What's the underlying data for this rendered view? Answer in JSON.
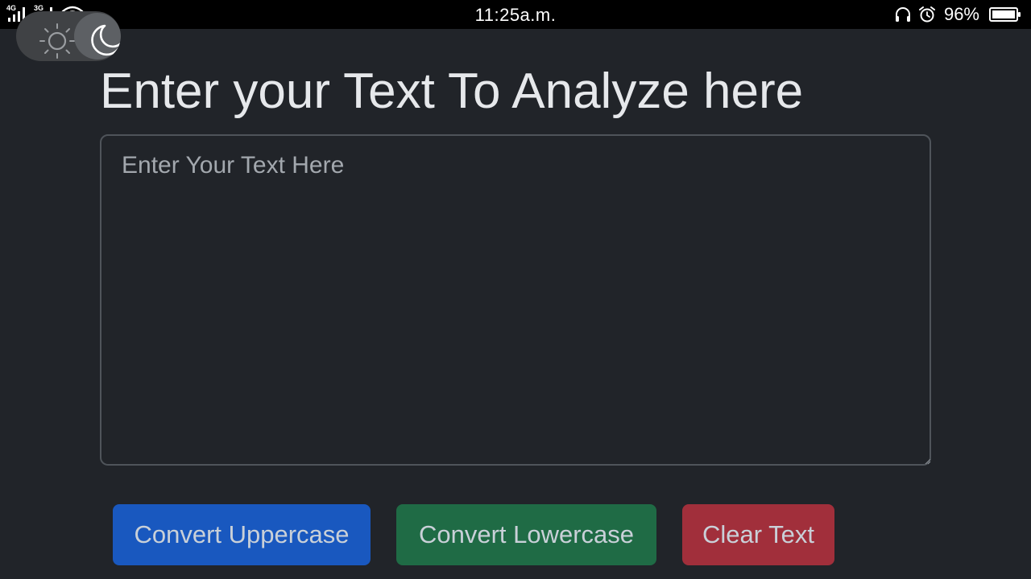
{
  "status_bar": {
    "sim1_network": "4G",
    "sim2_network": "3G",
    "time": "11:25a.m.",
    "battery_percent": "96%",
    "icons": [
      "signal-icon",
      "signal-icon",
      "wifi-icon",
      "headset-icon",
      "alarm-icon",
      "battery-icon"
    ]
  },
  "theme_toggle": {
    "mode": "dark",
    "icons": [
      "sun-icon",
      "moon-icon"
    ]
  },
  "page": {
    "title": "Enter your Text To Analyze here"
  },
  "text_input": {
    "placeholder": "Enter Your Text Here",
    "value": ""
  },
  "buttons": {
    "uppercase_label": "Convert Uppercase",
    "lowercase_label": "Convert Lowercase",
    "clear_label": "Clear Text"
  },
  "colors": {
    "background": "#212429",
    "title_text": "#e6e8eb",
    "uppercase_button": "#1958bf",
    "lowercase_button": "#1f6b45",
    "clear_button": "#a12f3b",
    "button_text": "#c9d0d8"
  }
}
